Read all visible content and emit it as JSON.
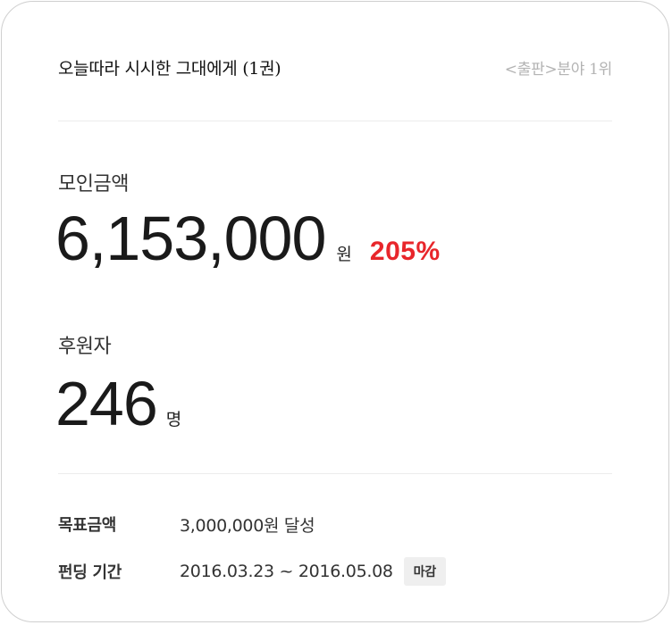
{
  "project": {
    "title": "오늘따라 시시한 그대에게 (1권)",
    "category_rank": "<출판>분야 1위"
  },
  "funding": {
    "raised_label": "모인금액",
    "raised_amount": "6,153,000",
    "raised_unit": "원",
    "achievement_percent": "205%",
    "backers_label": "후원자",
    "backers_count": "246",
    "backers_unit": "명"
  },
  "details": {
    "goal_label": "목표금액",
    "goal_value": "3,000,000원 달성",
    "period_label": "펀딩 기간",
    "period_value": "2016.03.23 ~ 2016.05.08",
    "status_badge": "마감"
  },
  "colors": {
    "accent_red": "#e8262b",
    "muted_text": "#b3b3b3",
    "badge_bg": "#efefef",
    "divider": "#ececec"
  }
}
